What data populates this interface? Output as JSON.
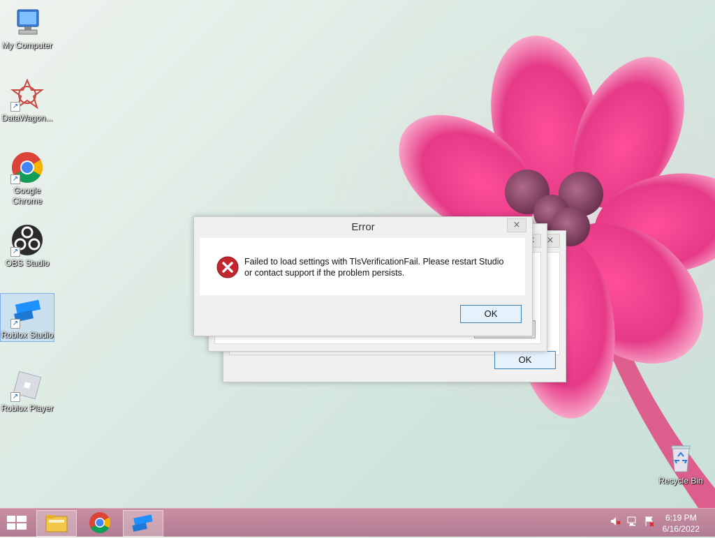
{
  "desktop": {
    "icons": [
      {
        "label": "My Computer",
        "icon": "computer-icon"
      },
      {
        "label": "DataWagon...",
        "icon": "datawagon-icon"
      },
      {
        "label": "Google Chrome",
        "icon": "chrome-icon"
      },
      {
        "label": "OBS Studio",
        "icon": "obs-icon"
      },
      {
        "label": "Roblox Studio",
        "icon": "roblox-studio-icon"
      },
      {
        "label": "Roblox Player",
        "icon": "roblox-player-icon"
      },
      {
        "label": "Recycle Bin",
        "icon": "recycle-bin-icon"
      }
    ]
  },
  "dialog": {
    "title": "Error",
    "close_glyph": "×",
    "message": "Failed to load settings with TlsVerificationFail. Please restart Studio or contact support if the problem persists.",
    "ok_label": "OK",
    "icon": "error-icon"
  },
  "back_dialogs": {
    "ok_label": "OK",
    "close_glyph": "×"
  },
  "taskbar": {
    "start_icon": "windows-start-icon",
    "pinned": [
      "file-explorer-icon",
      "chrome-icon",
      "roblox-studio-icon"
    ],
    "tray": [
      "volume-muted-icon",
      "network-icon",
      "action-center-icon"
    ],
    "time": "6:19 PM",
    "date": "6/16/2022"
  },
  "colors": {
    "error_red": "#c4262e",
    "taskbar": "#b27c92",
    "accent_blue": "#3c7fb1"
  }
}
